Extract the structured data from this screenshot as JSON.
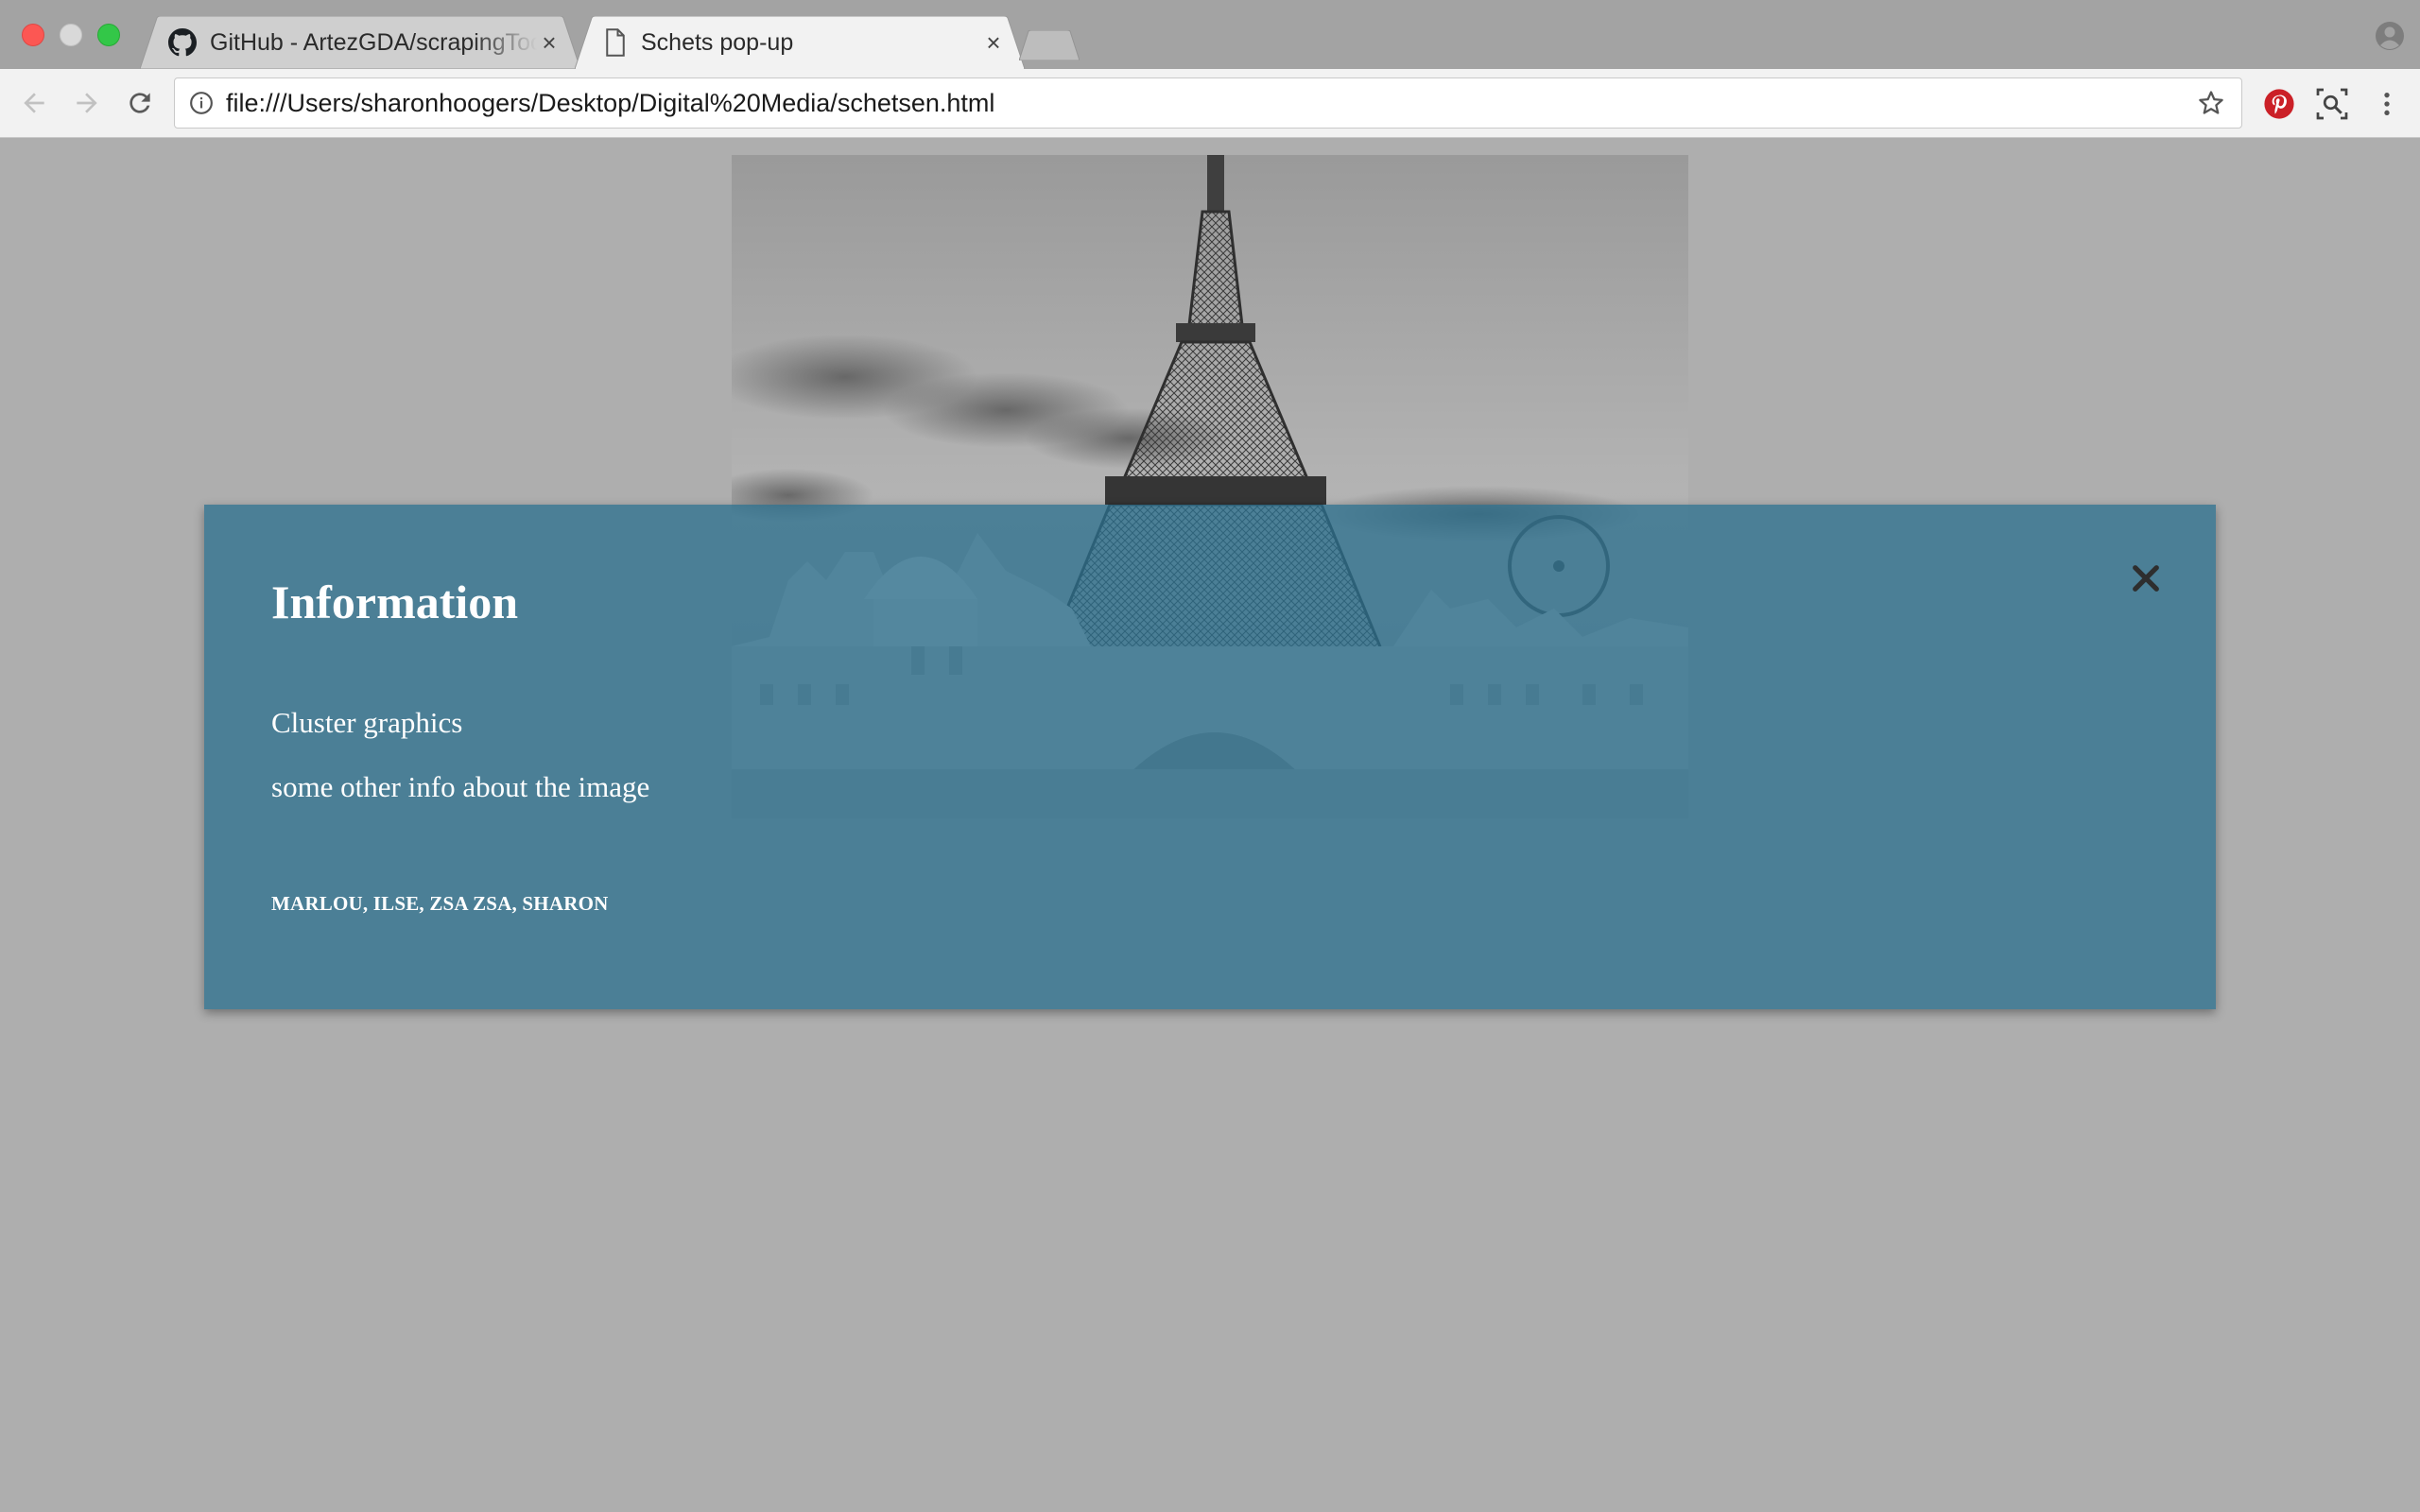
{
  "browser": {
    "tabs": [
      {
        "title": "GitHub - ArtezGDA/scrapingTools",
        "icon": "github-icon",
        "active": false
      },
      {
        "title": "Schets pop-up",
        "icon": "document-icon",
        "active": true
      }
    ],
    "address": "file:///Users/sharonhoogers/Desktop/Digital%20Media/schetsen.html",
    "close_glyph": "×"
  },
  "popup": {
    "title": "Information",
    "line1": "Cluster graphics",
    "line2": "some other info about the image",
    "credits": "MARLOU, ILSE, ZSA ZSA, SHARON",
    "close_glyph": "✕"
  },
  "colors": {
    "modal_background": "#2b708e",
    "page_background": "#aeaeae",
    "pinterest": "#cb2027"
  }
}
